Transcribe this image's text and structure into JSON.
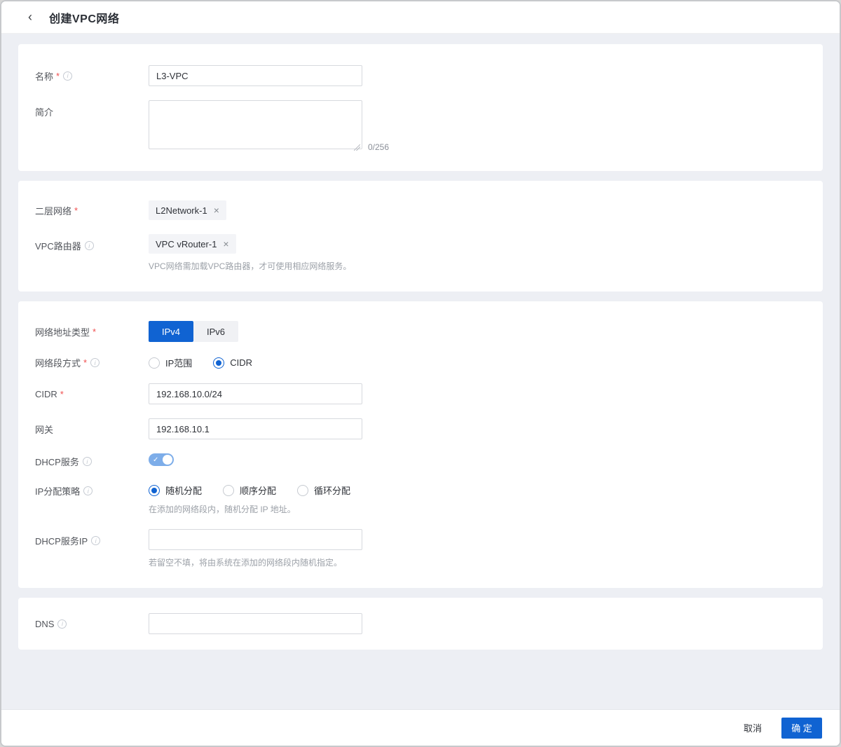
{
  "icons": {
    "back": "‹",
    "info": "i",
    "close": "×",
    "check": "✓"
  },
  "colors": {
    "primary": "#1063d2",
    "toggle_on": "#7dade9",
    "required": "#f04f4f",
    "body_bg": "#edeff4"
  },
  "header": {
    "title": "创建VPC网络"
  },
  "form": {
    "name": {
      "label": "名称",
      "value": "L3-VPC"
    },
    "description": {
      "label": "简介",
      "value": "",
      "counter": "0/256"
    },
    "l2network": {
      "label": "二层网络",
      "tag": "L2Network-1"
    },
    "vpc_router": {
      "label": "VPC路由器",
      "tag": "VPC vRouter-1",
      "hint": "VPC网络需加载VPC路由器，才可使用相应网络服务。"
    },
    "address_type": {
      "label": "网络地址类型",
      "options": [
        "IPv4",
        "IPv6"
      ],
      "selected": "IPv4"
    },
    "segment_mode": {
      "label": "网络段方式",
      "options": [
        "IP范围",
        "CIDR"
      ],
      "selected": "CIDR"
    },
    "cidr": {
      "label": "CIDR",
      "value": "192.168.10.0/24"
    },
    "gateway": {
      "label": "网关",
      "value": "192.168.10.1"
    },
    "dhcp": {
      "label": "DHCP服务",
      "enabled": true
    },
    "ip_alloc": {
      "label": "IP分配策略",
      "options": [
        "随机分配",
        "顺序分配",
        "循环分配"
      ],
      "selected": "随机分配",
      "hint": "在添加的网络段内，随机分配 IP 地址。"
    },
    "dhcp_ip": {
      "label": "DHCP服务IP",
      "value": "",
      "hint": "若留空不填，将由系统在添加的网络段内随机指定。"
    },
    "dns": {
      "label": "DNS",
      "value": ""
    }
  },
  "footer": {
    "cancel": "取消",
    "confirm": "确 定"
  }
}
